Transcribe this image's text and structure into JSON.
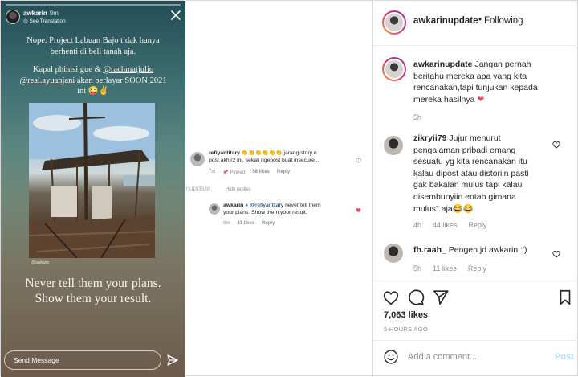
{
  "story": {
    "username": "awkarin",
    "time": "9m",
    "see_translation": "See Translation",
    "text_line1": "Nope. Project Labuan Bajo tidak hanya",
    "text_line2": "berhenti di beli tanah aja.",
    "text_line3_a": "Kapal phinisi gue & ",
    "mention1": "@rachmatjulio",
    "mention2": "@real.ayuanjani",
    "text_line4_b": " akan berlayar SOON 2021",
    "text_line5": "ini 😜✌",
    "photo_caption": "@awkarin",
    "quote_line1": "Never tell them your plans.",
    "quote_line2": "Show them your result.",
    "send_message": "Send Message"
  },
  "overlay": {
    "comment1": {
      "username": "refiyantitary",
      "emojis": "👏👏👏👏👏👏",
      "text_line1": "jarang story n",
      "text_line2": "post akhir2 ini, sekali ngepost buat insecure...",
      "time": "7m",
      "pinned": "Pinned",
      "likes": "58 likes",
      "reply": "Reply"
    },
    "hide_replies": "Hide replies",
    "reply1": {
      "username": "awkarin",
      "mention": "@refiyantitary",
      "text_line1": "never tell them",
      "text_line2": "your plans. Show them your result.",
      "time": "6m",
      "likes": "41 likes",
      "reply": "Reply"
    },
    "watermark": "@awkarinupdate"
  },
  "post": {
    "header": {
      "username": "awkarinupdate",
      "dot": "•",
      "following": "Following"
    },
    "caption": {
      "username": "awkarinupdate",
      "line1": "Jangan pernah",
      "line2": "beritahu mereka apa yang kita",
      "line3": "rencanakan,tapi tunjukan kepada",
      "line4": "mereka hasilnya",
      "heart": "❤",
      "time": "5h"
    },
    "comments": [
      {
        "username": "zikryii79",
        "line1": "Jujur menurut",
        "line2": "pengalaman pribadi emang",
        "line3": "sesuatu yg kita rencanakan itu",
        "line4": "kalau dipost atau distoriin pasti",
        "line5": "gak bakalan mulus tapi kalau",
        "line6": "disembunyiin entah gimana",
        "line7": "mulus\" aja😂😂",
        "time": "4h",
        "likes": "44 likes",
        "reply": "Reply"
      },
      {
        "username": "fh.raah_",
        "line1": "Pengen jd awkarin :')",
        "time": "5h",
        "likes": "11 likes",
        "reply": "Reply"
      }
    ],
    "likes_count": "7,063 likes",
    "posted_ago": "5 HOURS AGO",
    "add_comment_placeholder": "Add a comment...",
    "post_button": "Post"
  },
  "icons": {
    "close": "close-icon",
    "send": "paper-plane-icon",
    "like": "heart-icon",
    "comment": "comment-icon",
    "share": "paper-plane-icon",
    "save": "bookmark-icon",
    "emoji": "smiley-icon",
    "more": "more-dots-icon",
    "pin": "pin-icon"
  },
  "colors": {
    "heart_red": "#ed4956",
    "link_blue": "#0095f6",
    "post_disabled": "#b2dffc",
    "meta_gray": "#8e8e8e"
  }
}
